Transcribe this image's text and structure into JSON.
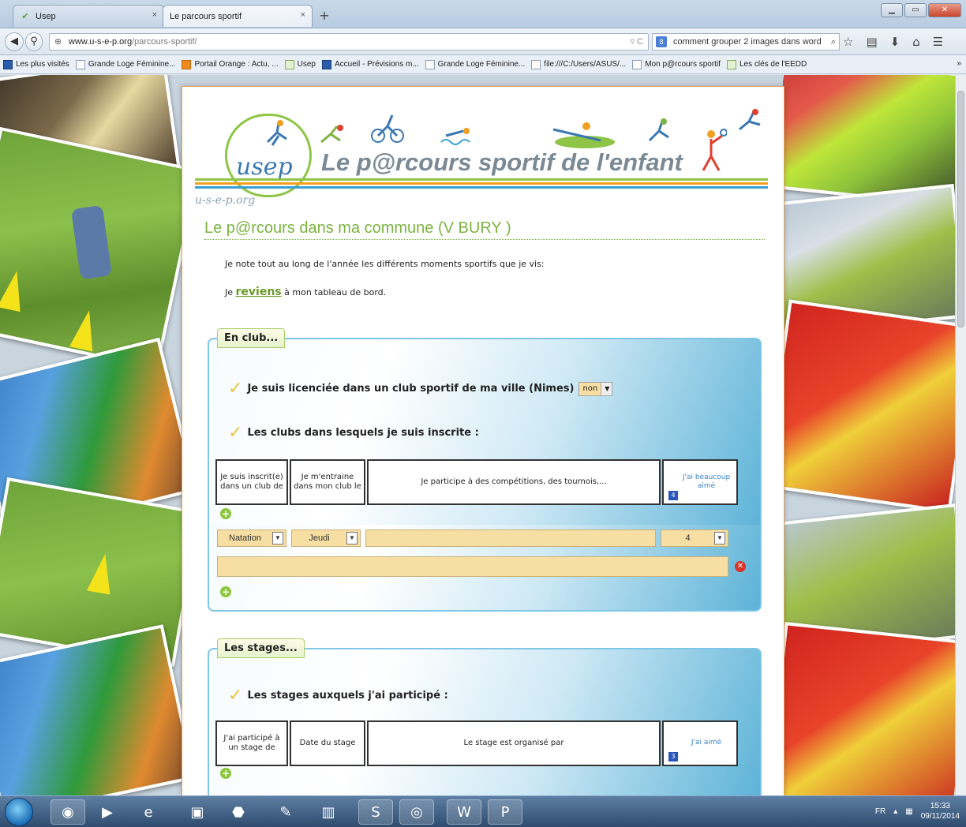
{
  "browser": {
    "tabs": [
      {
        "label": "Usep",
        "close": "×"
      },
      {
        "label": "Le parcours sportif",
        "close": "×"
      }
    ],
    "new_tab": "+",
    "url_host": "www.u-s-e-p.org",
    "url_path": "/parcours-sportif/",
    "search_text": "comment grouper 2 images dans word",
    "bookmarks": [
      "Les plus visités",
      "Grande Loge Féminine...",
      "Portail Orange : Actu, ...",
      "Usep",
      "Accueil - Prévisions m...",
      "Grande Loge Féminine...",
      "file:///C:/Users/ASUS/...",
      "Mon p@rcours sportif",
      "Les clés de l'EEDD"
    ],
    "bookmarks_more": "»"
  },
  "header": {
    "logo": "usep",
    "title": "Le p@rcours sportif de l'enfant",
    "subtitle": "u-s-e-p.org"
  },
  "main": {
    "heading": "Le p@rcours dans ma commune (V BURY )",
    "intro_line": "Je note tout au long de l'année les différents moments sportifs que je vis:",
    "intro2_prefix": "Je",
    "intro2_link": "reviens",
    "intro2_suffix": "à mon tableau de bord."
  },
  "club": {
    "title": "En club...",
    "q1": "Je suis licenciée dans un club sportif de ma ville (Nimes)",
    "q1_value": "non",
    "q2": "Les clubs dans lesquels je suis inscrite :",
    "columns": [
      "Je suis inscrit(e) dans un club de",
      "Je m'entraine dans mon club le",
      "Je participe à des compétitions, des tournois,...",
      "J'ai beaucoup aimé"
    ],
    "like_badge": "4",
    "row": {
      "sport": "Natation",
      "day": "Jeudi",
      "competitions": "",
      "rating": "4",
      "comment": ""
    }
  },
  "stages": {
    "title": "Les stages...",
    "q1": "Les stages auxquels j'ai participé :",
    "columns": [
      "J'ai participé à un stage de",
      "Date du stage",
      "Le stage est organisé par",
      "J'ai aimé"
    ],
    "like_badge": "3"
  },
  "taskbar": {
    "lang": "FR",
    "time": "15:33",
    "date": "09/11/2014"
  },
  "colors": {
    "accent_green": "#7cb342",
    "section_blue": "#5db3d8",
    "field_beige": "#f7dfa3"
  }
}
